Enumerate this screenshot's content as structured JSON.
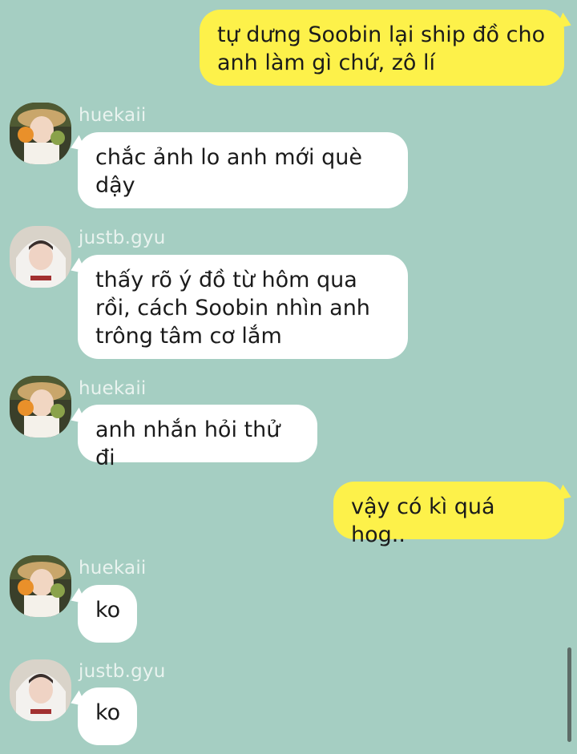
{
  "messages": [
    {
      "type": "out",
      "text": "tự dưng Soobin lại ship đồ cho anh làm gì chứ, zô lí"
    },
    {
      "type": "in",
      "sender": "huekaii",
      "text": "chắc ảnh lo anh mới què dậy"
    },
    {
      "type": "in",
      "sender": "justb.gyu",
      "text": "thấy rõ ý đồ từ hôm qua rồi, cách Soobin nhìn anh trông tâm cơ lắm"
    },
    {
      "type": "in",
      "sender": "huekaii",
      "text": "anh nhắn hỏi thử đi"
    },
    {
      "type": "out",
      "text": "vậy có kì quá hog.."
    },
    {
      "type": "in",
      "sender": "huekaii",
      "text": "ko"
    },
    {
      "type": "in",
      "sender": "justb.gyu",
      "text": "ko"
    }
  ],
  "avatars": {
    "huekaii": "avatar-huekaii",
    "justb.gyu": "avatar-justb-gyu"
  },
  "colors": {
    "background": "#a5cec2",
    "incoming_bubble": "#ffffff",
    "outgoing_bubble": "#fdf14a",
    "sender_name": "#e9f3ef"
  }
}
